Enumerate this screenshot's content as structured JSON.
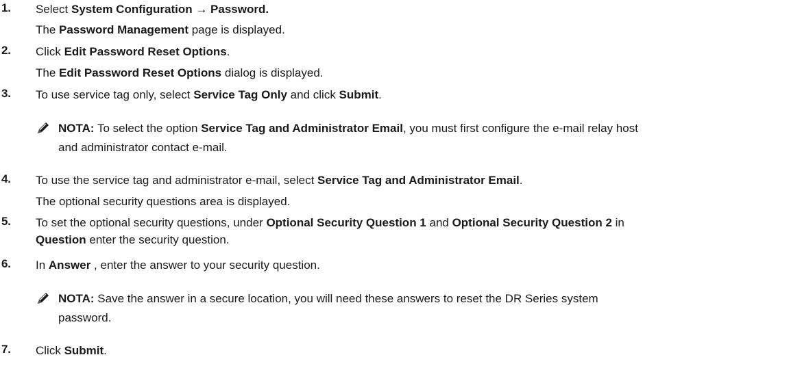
{
  "steps": [
    {
      "num": "1.",
      "line1": {
        "pre": "Select ",
        "b1": "System Configuration → Password.",
        "post": ""
      },
      "line2": {
        "pre": "The ",
        "b1": "Password Management",
        "post": " page is displayed."
      }
    },
    {
      "num": "2.",
      "line1": {
        "pre": "Click ",
        "b1": "Edit Password Reset Options",
        "post": "."
      },
      "line2": {
        "pre": "The ",
        "b1": "Edit Password Reset Options",
        "post": " dialog is displayed."
      }
    },
    {
      "num": "3.",
      "line1": {
        "pre": "To use service tag only, select ",
        "b1": "Service Tag Only",
        "mid": " and click ",
        "b2": "Submit",
        "post": "."
      }
    },
    {
      "num": "4.",
      "line1": {
        "pre": "To use the service tag and administrator e-mail, select ",
        "b1": "Service Tag and Administrator Email",
        "post": "."
      },
      "line2": {
        "text": "The optional security questions area is displayed."
      }
    },
    {
      "num": "5.",
      "line1": {
        "pre": "To set the optional security questions, under ",
        "b1": "Optional Security Question 1",
        "mid": " and ",
        "b2": "Optional Security Question 2",
        "post": " in"
      },
      "line2": {
        "b1": "Question",
        "post": " enter the security question."
      }
    },
    {
      "num": "6.",
      "line1": {
        "pre": "In ",
        "b1": "Answer",
        "post": " , enter the answer to your security question."
      }
    },
    {
      "num": "7.",
      "line1": {
        "pre": "Click ",
        "b1": "Submit",
        "post": "."
      }
    }
  ],
  "notes": [
    {
      "icon": "pencil-icon",
      "label": "NOTA:",
      "row1": {
        "pre": " To select the option ",
        "b1": "Service Tag and Administrator Email",
        "post": ", you must first configure the e-mail relay host"
      },
      "row2": "and administrator contact e-mail."
    },
    {
      "icon": "pencil-icon",
      "label": "NOTA:",
      "row1": {
        "pre": " Save the answer in a secure location, you will need these answers to reset the DR Series system"
      },
      "row2": "password."
    }
  ]
}
